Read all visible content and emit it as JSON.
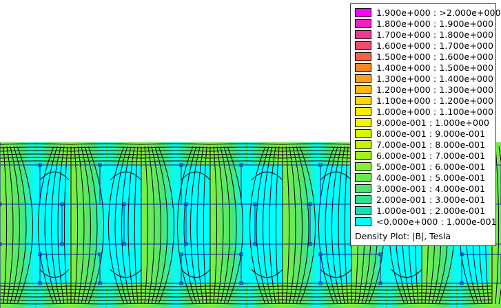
{
  "legend": {
    "title": "Density Plot: |B|, Tesla",
    "entries": [
      {
        "label": "1.900e+000 : >2.000e+000",
        "color": "#ff00ff"
      },
      {
        "label": "1.800e+000 : 1.900e+000",
        "color": "#f41fc0"
      },
      {
        "label": "1.700e+000 : 1.800e+000",
        "color": "#ec3a93"
      },
      {
        "label": "1.600e+000 : 1.700e+000",
        "color": "#ed4f6a"
      },
      {
        "label": "1.500e+000 : 1.600e+000",
        "color": "#f2643f"
      },
      {
        "label": "1.400e+000 : 1.500e+000",
        "color": "#f7862a"
      },
      {
        "label": "1.300e+000 : 1.400e+000",
        "color": "#faa01c"
      },
      {
        "label": "1.200e+000 : 1.300e+000",
        "color": "#fcba12"
      },
      {
        "label": "1.100e+000 : 1.200e+000",
        "color": "#fed708"
      },
      {
        "label": "1.000e+000 : 1.100e+000",
        "color": "#ffec00"
      },
      {
        "label": "9.000e-001 : 1.000e+000",
        "color": "#f3f800"
      },
      {
        "label": "8.000e-001 : 9.000e-001",
        "color": "#d8f700"
      },
      {
        "label": "7.000e-001 : 8.000e-001",
        "color": "#bef500"
      },
      {
        "label": "6.000e-001 : 7.000e-001",
        "color": "#a2f21c"
      },
      {
        "label": "5.000e-001 : 6.000e-001",
        "color": "#86ee38"
      },
      {
        "label": "4.000e-001 : 5.000e-001",
        "color": "#6ae954"
      },
      {
        "label": "3.000e-001 : 4.000e-001",
        "color": "#4ee470"
      },
      {
        "label": "2.000e-001 : 3.000e-001",
        "color": "#32e18c"
      },
      {
        "label": "1.000e-001 : 2.000e-001",
        "color": "#17e0b8"
      },
      {
        "label": "<0.000e+000 : 1.000e-001",
        "color": "#00ffff"
      }
    ]
  },
  "colors": {
    "background": "#ffffff",
    "low_field": "#00ffff",
    "flux_line": "#000000",
    "geometry": "#1a1ab0"
  }
}
